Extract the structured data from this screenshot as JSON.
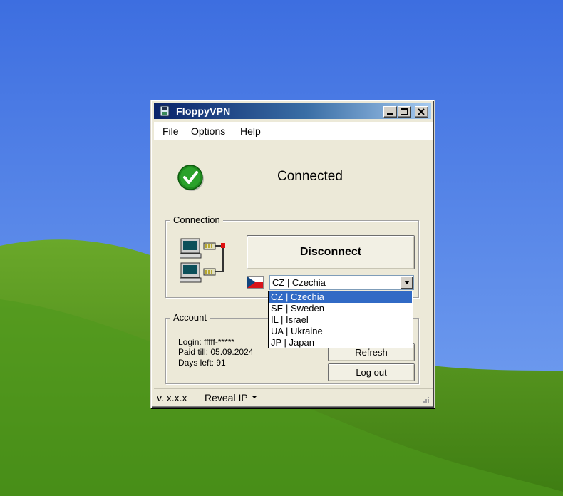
{
  "window": {
    "title": "FloppyVPN",
    "icon": "floppy-icon"
  },
  "menu": {
    "items": [
      "File",
      "Options",
      "Help"
    ]
  },
  "status": {
    "text": "Connected",
    "icon": "check-circle-icon",
    "color": "#1f8a1f"
  },
  "connection": {
    "group_label": "Connection",
    "button_label": "Disconnect",
    "selected_country": "CZ | Czechia",
    "options": [
      "CZ | Czechia",
      "SE | Sweden",
      "IL | Israel",
      "UA | Ukraine",
      "JP | Japan"
    ]
  },
  "account": {
    "group_label": "Account",
    "login": "Login: fffff-*****",
    "paid_till": "Paid till: 05.09.2024",
    "days_left": "Days left: 91",
    "refresh_label": "Refresh",
    "logout_label": "Log out"
  },
  "statusbar": {
    "version": "v. x.x.x",
    "reveal_ip_label": "Reveal IP"
  },
  "colors": {
    "selection": "#316ac5",
    "window_face": "#ece9d8"
  }
}
